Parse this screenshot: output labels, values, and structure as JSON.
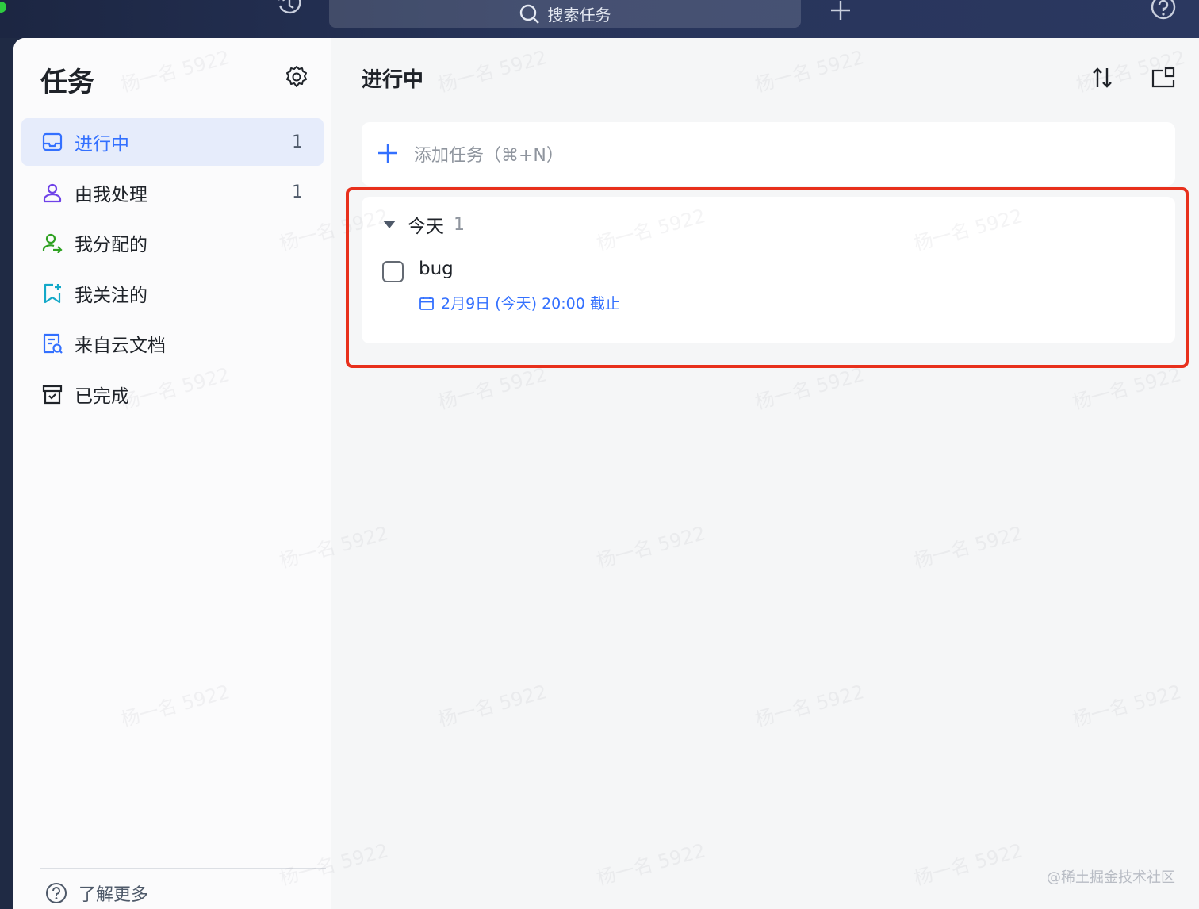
{
  "titlebar": {
    "search_placeholder": "搜索任务"
  },
  "sidebar": {
    "title": "任务",
    "items": [
      {
        "label": "进行中",
        "count": "1",
        "icon": "inbox-icon",
        "active": true
      },
      {
        "label": "由我处理",
        "count": "1",
        "icon": "person-icon"
      },
      {
        "label": "我分配的",
        "count": "",
        "icon": "person-assign-icon"
      },
      {
        "label": "我关注的",
        "count": "",
        "icon": "bookmark-star-icon"
      },
      {
        "label": "来自云文档",
        "count": "",
        "icon": "cloud-doc-icon"
      },
      {
        "label": "已完成",
        "count": "",
        "icon": "archive-box-icon"
      }
    ],
    "learn_more": "了解更多"
  },
  "main": {
    "title": "进行中",
    "add_task": "添加任务（⌘+N）",
    "group": {
      "name": "今天",
      "count": "1",
      "tasks": [
        {
          "title": "bug",
          "due": "2月9日 (今天) 20:00 截止"
        }
      ]
    }
  },
  "watermark": "杨一名 5922",
  "credit": "@稀土掘金技术社区",
  "colors": {
    "accent": "#3370ff",
    "highlight_border": "#e8301c",
    "titlebar": "#27345a"
  }
}
